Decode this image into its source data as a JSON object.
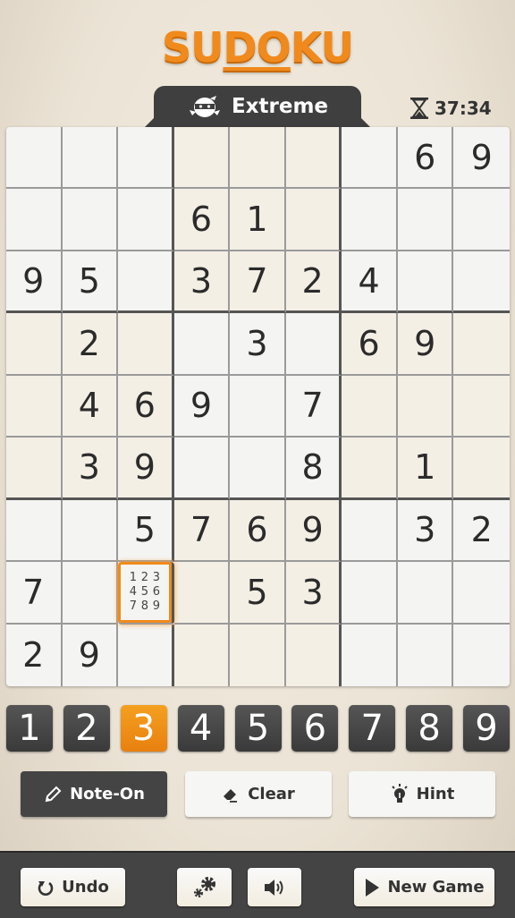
{
  "header": {
    "logo_parts": [
      "SU",
      "DO",
      "KU"
    ],
    "difficulty": "Extreme",
    "difficulty_icon": "ninja-icon",
    "timer": "37:34",
    "timer_icon": "hourglass-icon"
  },
  "board": {
    "cells": [
      [
        "",
        "",
        "",
        "",
        "",
        "",
        "",
        "6",
        "9"
      ],
      [
        "",
        "",
        "",
        "6",
        "1",
        "",
        "",
        "",
        ""
      ],
      [
        "9",
        "5",
        "",
        "3",
        "7",
        "2",
        "4",
        "",
        ""
      ],
      [
        "",
        "2",
        "",
        "",
        "3",
        "",
        "6",
        "9",
        ""
      ],
      [
        "",
        "4",
        "6",
        "9",
        "",
        "7",
        "",
        "",
        ""
      ],
      [
        "",
        "3",
        "9",
        "",
        "",
        "8",
        "",
        "1",
        ""
      ],
      [
        "",
        "",
        "5",
        "7",
        "6",
        "9",
        "",
        "3",
        "2"
      ],
      [
        "7",
        "",
        "",
        "",
        "5",
        "3",
        "",
        "",
        ""
      ],
      [
        "2",
        "9",
        "",
        "",
        "",
        "",
        "",
        "",
        ""
      ]
    ],
    "selected_cell": {
      "row": 8,
      "col": 3
    },
    "selected_cell_notes": [
      "1",
      "2",
      "3",
      "4",
      "5",
      "6",
      "7",
      "8",
      "9"
    ]
  },
  "numpad": {
    "numbers": [
      "1",
      "2",
      "3",
      "4",
      "5",
      "6",
      "7",
      "8",
      "9"
    ],
    "active": "3"
  },
  "tools": {
    "note": "Note-On",
    "clear": "Clear",
    "hint": "Hint"
  },
  "bottom_bar": {
    "undo": "Undo",
    "new_game": "New Game"
  },
  "colors": {
    "accent": "#f08a1c",
    "dark_button": "#444444",
    "cell_alt": "#f4efe5",
    "cell_plain": "#f4f4f3"
  }
}
